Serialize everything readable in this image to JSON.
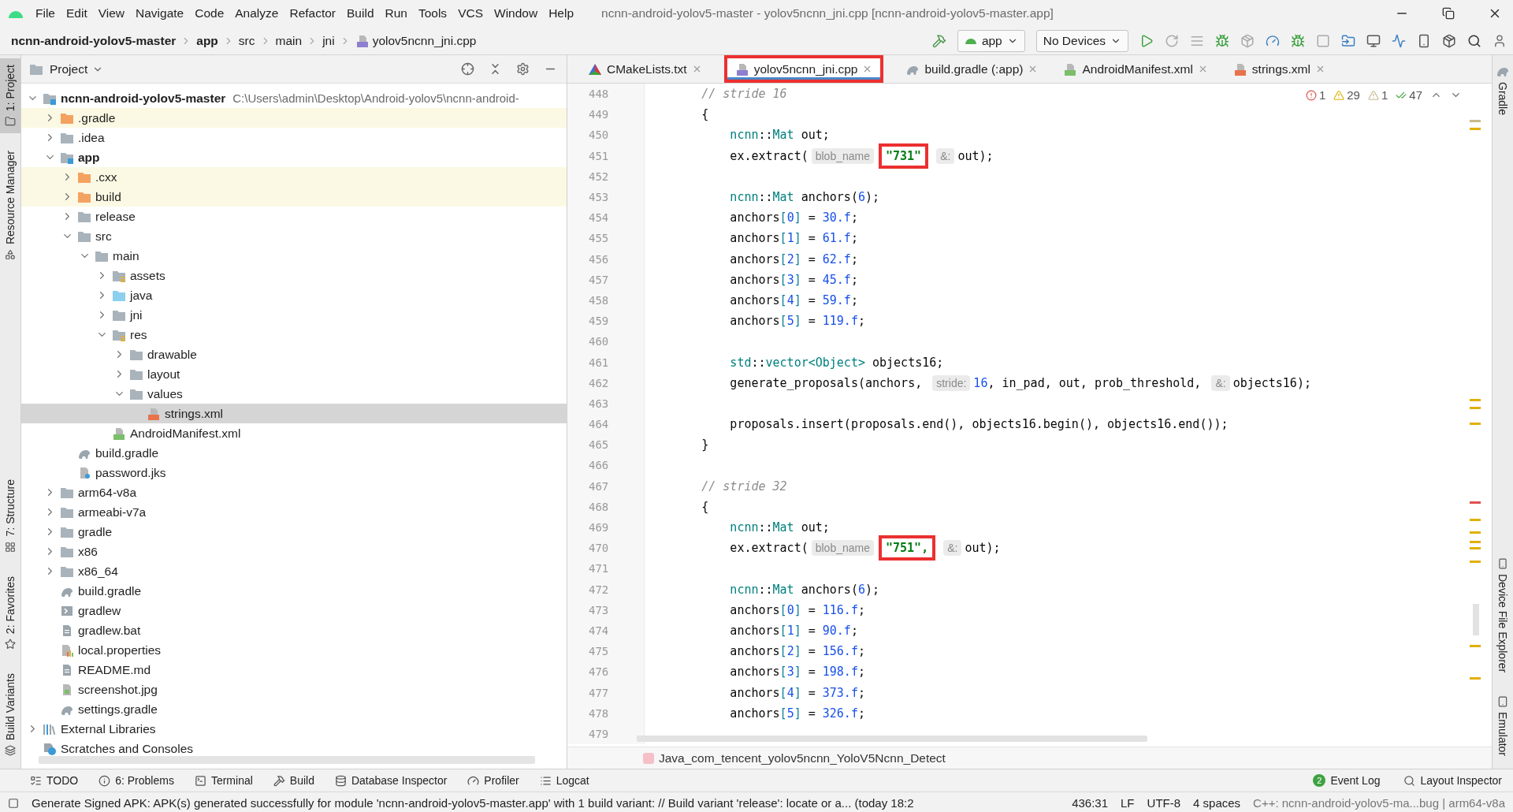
{
  "menu_bar": {
    "items": [
      "File",
      "Edit",
      "View",
      "Navigate",
      "Code",
      "Analyze",
      "Refactor",
      "Build",
      "Run",
      "Tools",
      "VCS",
      "Window",
      "Help"
    ],
    "title": "ncnn-android-yolov5-master - yolov5ncnn_jni.cpp [ncnn-android-yolov5-master.app]"
  },
  "nav_bar": {
    "breadcrumbs": [
      {
        "label": "ncnn-android-yolov5-master",
        "kind": "module"
      },
      {
        "label": "app",
        "kind": "module"
      },
      {
        "label": "src",
        "kind": "folder"
      },
      {
        "label": "main",
        "kind": "folder"
      },
      {
        "label": "jni",
        "kind": "folder"
      },
      {
        "label": "yolov5ncnn_jni.cpp",
        "kind": "cpp"
      }
    ],
    "run_config": "app",
    "device": "No Devices"
  },
  "left_strip": {
    "top": [
      {
        "label": "1: Project",
        "kind": "folder",
        "selected": true
      },
      {
        "label": "Resource Manager",
        "kind": "shapes",
        "selected": false
      }
    ],
    "bottom": [
      {
        "label": "7: Structure",
        "kind": "structure",
        "selected": false
      },
      {
        "label": "2: Favorites",
        "kind": "star",
        "selected": false
      },
      {
        "label": "Build Variants",
        "kind": "variants",
        "selected": false
      }
    ]
  },
  "right_strip": {
    "top": [
      {
        "label": "Gradle",
        "kind": "elephant"
      }
    ],
    "bottom": [
      {
        "label": "Device File Explorer",
        "kind": "phone"
      },
      {
        "label": "Emulator",
        "kind": "emulator"
      }
    ]
  },
  "project_panel": {
    "title": "Project",
    "tree": [
      {
        "label": "ncnn-android-yolov5-master",
        "path": "C:\\Users\\admin\\Desktop\\Android-yolov5\\ncnn-android-",
        "kind": "module",
        "expanded": true,
        "selected": false,
        "excluded": false,
        "children": [
          {
            "label": ".gradle",
            "kind": "folder-orange",
            "expanded": false,
            "selected": false,
            "excluded": true
          },
          {
            "label": ".idea",
            "kind": "folder",
            "expanded": false,
            "selected": false,
            "excluded": false
          },
          {
            "label": "app",
            "kind": "module",
            "expanded": true,
            "selected": false,
            "excluded": false,
            "children": [
              {
                "label": ".cxx",
                "kind": "folder-orange",
                "expanded": false,
                "selected": false,
                "excluded": true
              },
              {
                "label": "build",
                "kind": "folder-orange",
                "expanded": false,
                "selected": false,
                "excluded": true
              },
              {
                "label": "release",
                "kind": "folder",
                "expanded": false,
                "selected": false,
                "excluded": false
              },
              {
                "label": "src",
                "kind": "folder",
                "expanded": true,
                "selected": false,
                "excluded": false,
                "children": [
                  {
                    "label": "main",
                    "kind": "folder",
                    "expanded": true,
                    "selected": false,
                    "excluded": false,
                    "children": [
                      {
                        "label": "assets",
                        "kind": "res-folder",
                        "expanded": false,
                        "selected": false,
                        "excluded": false
                      },
                      {
                        "label": "java",
                        "kind": "folder-blue",
                        "expanded": false,
                        "selected": false,
                        "excluded": false
                      },
                      {
                        "label": "jni",
                        "kind": "folder",
                        "expanded": false,
                        "selected": false,
                        "excluded": false
                      },
                      {
                        "label": "res",
                        "kind": "res-folder",
                        "expanded": true,
                        "selected": false,
                        "excluded": false,
                        "children": [
                          {
                            "label": "drawable",
                            "kind": "folder",
                            "expanded": false,
                            "selected": false,
                            "excluded": false
                          },
                          {
                            "label": "layout",
                            "kind": "folder",
                            "expanded": false,
                            "selected": false,
                            "excluded": false
                          },
                          {
                            "label": "values",
                            "kind": "folder",
                            "expanded": true,
                            "selected": false,
                            "excluded": false,
                            "children": [
                              {
                                "label": "strings.xml",
                                "kind": "xml",
                                "selected": true,
                                "excluded": false
                              }
                            ]
                          }
                        ]
                      },
                      {
                        "label": "AndroidManifest.xml",
                        "kind": "manifest",
                        "selected": false,
                        "excluded": false
                      }
                    ]
                  }
                ]
              },
              {
                "label": "build.gradle",
                "kind": "gradle",
                "selected": false,
                "excluded": false
              },
              {
                "label": "password.jks",
                "kind": "key",
                "selected": false,
                "excluded": false
              }
            ]
          },
          {
            "label": "arm64-v8a",
            "kind": "folder",
            "expanded": false,
            "selected": false,
            "excluded": false
          },
          {
            "label": "armeabi-v7a",
            "kind": "folder",
            "expanded": false,
            "selected": false,
            "excluded": false
          },
          {
            "label": "gradle",
            "kind": "folder",
            "expanded": false,
            "selected": false,
            "excluded": false
          },
          {
            "label": "x86",
            "kind": "folder",
            "expanded": false,
            "selected": false,
            "excluded": false
          },
          {
            "label": "x86_64",
            "kind": "folder",
            "expanded": false,
            "selected": false,
            "excluded": false
          },
          {
            "label": "build.gradle",
            "kind": "gradle",
            "selected": false,
            "excluded": false
          },
          {
            "label": "gradlew",
            "kind": "script",
            "selected": false,
            "excluded": false
          },
          {
            "label": "gradlew.bat",
            "kind": "text",
            "selected": false,
            "excluded": false
          },
          {
            "label": "local.properties",
            "kind": "properties",
            "selected": false,
            "excluded": false
          },
          {
            "label": "README.md",
            "kind": "text",
            "selected": false,
            "excluded": false
          },
          {
            "label": "screenshot.jpg",
            "kind": "image",
            "selected": false,
            "excluded": false
          },
          {
            "label": "settings.gradle",
            "kind": "gradle",
            "selected": false,
            "excluded": false
          }
        ]
      },
      {
        "label": "External Libraries",
        "kind": "libraries",
        "expanded": false,
        "selected": false,
        "excluded": false
      },
      {
        "label": "Scratches and Consoles",
        "kind": "scratches",
        "selected": false,
        "excluded": false
      }
    ]
  },
  "editor": {
    "tabs": [
      {
        "label": "CMakeLists.txt",
        "kind": "cmake",
        "selected": false,
        "marked": false
      },
      {
        "label": "yolov5ncnn_jni.cpp",
        "kind": "cpp",
        "selected": true,
        "marked": true
      },
      {
        "label": "build.gradle (:app)",
        "kind": "gradle",
        "selected": false,
        "marked": false
      },
      {
        "label": "AndroidManifest.xml",
        "kind": "manifest",
        "selected": false,
        "marked": false
      },
      {
        "label": "strings.xml",
        "kind": "xml",
        "selected": false,
        "marked": false
      }
    ],
    "inspections": {
      "errors": "1",
      "warnings": "29",
      "weak_warnings": "1",
      "passed": "47"
    },
    "lines": [
      {
        "number": "448",
        "tokens": [
          {
            "kind": "comment",
            "text": "        // stride 16"
          }
        ]
      },
      {
        "number": "449",
        "tokens": [
          {
            "kind": "plain",
            "text": "        {"
          }
        ]
      },
      {
        "number": "450",
        "tokens": [
          {
            "kind": "type",
            "text": "            ncnn"
          },
          {
            "kind": "plain",
            "text": "::"
          },
          {
            "kind": "type",
            "text": "Mat"
          },
          {
            "kind": "plain",
            "text": " out;"
          }
        ]
      },
      {
        "number": "451",
        "tokens": [
          {
            "kind": "plain",
            "text": "            ex.extract("
          },
          {
            "kind": "hint",
            "text": "blob_name"
          },
          {
            "kind": "marked",
            "text": "\"731\""
          },
          {
            "kind": "hint",
            "text": "&:"
          },
          {
            "kind": "plain",
            "text": "out);"
          }
        ]
      },
      {
        "number": "452"
      },
      {
        "number": "453",
        "tokens": [
          {
            "kind": "type",
            "text": "            ncnn"
          },
          {
            "kind": "plain",
            "text": "::"
          },
          {
            "kind": "type",
            "text": "Mat"
          },
          {
            "kind": "plain",
            "text": " anchors("
          },
          {
            "kind": "number",
            "text": "6"
          },
          {
            "kind": "plain",
            "text": ");"
          }
        ]
      },
      {
        "number": "454",
        "tokens": [
          {
            "kind": "plain",
            "text": "            anchors"
          },
          {
            "kind": "bracket",
            "text": "["
          },
          {
            "kind": "number",
            "text": "0"
          },
          {
            "kind": "bracket",
            "text": "]"
          },
          {
            "kind": "plain",
            "text": " = "
          },
          {
            "kind": "number",
            "text": "30.f"
          },
          {
            "kind": "plain",
            "text": ";"
          }
        ]
      },
      {
        "number": "455",
        "tokens": [
          {
            "kind": "plain",
            "text": "            anchors"
          },
          {
            "kind": "bracket",
            "text": "["
          },
          {
            "kind": "number",
            "text": "1"
          },
          {
            "kind": "bracket",
            "text": "]"
          },
          {
            "kind": "plain",
            "text": " = "
          },
          {
            "kind": "number",
            "text": "61.f"
          },
          {
            "kind": "plain",
            "text": ";"
          }
        ]
      },
      {
        "number": "456",
        "tokens": [
          {
            "kind": "plain",
            "text": "            anchors"
          },
          {
            "kind": "bracket",
            "text": "["
          },
          {
            "kind": "number",
            "text": "2"
          },
          {
            "kind": "bracket",
            "text": "]"
          },
          {
            "kind": "plain",
            "text": " = "
          },
          {
            "kind": "number",
            "text": "62.f"
          },
          {
            "kind": "plain",
            "text": ";"
          }
        ]
      },
      {
        "number": "457",
        "tokens": [
          {
            "kind": "plain",
            "text": "            anchors"
          },
          {
            "kind": "bracket",
            "text": "["
          },
          {
            "kind": "number",
            "text": "3"
          },
          {
            "kind": "bracket",
            "text": "]"
          },
          {
            "kind": "plain",
            "text": " = "
          },
          {
            "kind": "number",
            "text": "45.f"
          },
          {
            "kind": "plain",
            "text": ";"
          }
        ]
      },
      {
        "number": "458",
        "tokens": [
          {
            "kind": "plain",
            "text": "            anchors"
          },
          {
            "kind": "bracket",
            "text": "["
          },
          {
            "kind": "number",
            "text": "4"
          },
          {
            "kind": "bracket",
            "text": "]"
          },
          {
            "kind": "plain",
            "text": " = "
          },
          {
            "kind": "number",
            "text": "59.f"
          },
          {
            "kind": "plain",
            "text": ";"
          }
        ]
      },
      {
        "number": "459",
        "tokens": [
          {
            "kind": "plain",
            "text": "            anchors"
          },
          {
            "kind": "bracket",
            "text": "["
          },
          {
            "kind": "number",
            "text": "5"
          },
          {
            "kind": "bracket",
            "text": "]"
          },
          {
            "kind": "plain",
            "text": " = "
          },
          {
            "kind": "number",
            "text": "119.f"
          },
          {
            "kind": "plain",
            "text": ";"
          }
        ]
      },
      {
        "number": "460"
      },
      {
        "number": "461",
        "tokens": [
          {
            "kind": "type",
            "text": "            std"
          },
          {
            "kind": "plain",
            "text": "::"
          },
          {
            "kind": "type",
            "text": "vector<Object>"
          },
          {
            "kind": "plain",
            "text": " objects16;"
          }
        ]
      },
      {
        "number": "462",
        "tokens": [
          {
            "kind": "plain",
            "text": "            generate_proposals(anchors, "
          },
          {
            "kind": "hint",
            "text": "stride:"
          },
          {
            "kind": "number",
            "text": "16"
          },
          {
            "kind": "plain",
            "text": ", in_pad, out, prob_threshold, "
          },
          {
            "kind": "hint",
            "text": "&:"
          },
          {
            "kind": "plain",
            "text": "objects16);"
          }
        ]
      },
      {
        "number": "463"
      },
      {
        "number": "464",
        "tokens": [
          {
            "kind": "plain",
            "text": "            proposals.insert(proposals.end(), objects16.begin(), objects16.end());"
          }
        ]
      },
      {
        "number": "465",
        "tokens": [
          {
            "kind": "plain",
            "text": "        }"
          }
        ]
      },
      {
        "number": "466"
      },
      {
        "number": "467",
        "tokens": [
          {
            "kind": "comment",
            "text": "        // stride 32"
          }
        ]
      },
      {
        "number": "468",
        "tokens": [
          {
            "kind": "plain",
            "text": "        {"
          }
        ]
      },
      {
        "number": "469",
        "tokens": [
          {
            "kind": "type",
            "text": "            ncnn"
          },
          {
            "kind": "plain",
            "text": "::"
          },
          {
            "kind": "type",
            "text": "Mat"
          },
          {
            "kind": "plain",
            "text": " out;"
          }
        ]
      },
      {
        "number": "470",
        "tokens": [
          {
            "kind": "plain",
            "text": "            ex.extract("
          },
          {
            "kind": "hint",
            "text": "blob_name"
          },
          {
            "kind": "marked",
            "text": "\"751\","
          },
          {
            "kind": "hint",
            "text": "&:"
          },
          {
            "kind": "plain",
            "text": "out);"
          }
        ]
      },
      {
        "number": "471"
      },
      {
        "number": "472",
        "tokens": [
          {
            "kind": "type",
            "text": "            ncnn"
          },
          {
            "kind": "plain",
            "text": "::"
          },
          {
            "kind": "type",
            "text": "Mat"
          },
          {
            "kind": "plain",
            "text": " anchors("
          },
          {
            "kind": "number",
            "text": "6"
          },
          {
            "kind": "plain",
            "text": ");"
          }
        ]
      },
      {
        "number": "473",
        "tokens": [
          {
            "kind": "plain",
            "text": "            anchors"
          },
          {
            "kind": "bracket",
            "text": "["
          },
          {
            "kind": "number",
            "text": "0"
          },
          {
            "kind": "bracket",
            "text": "]"
          },
          {
            "kind": "plain",
            "text": " = "
          },
          {
            "kind": "number",
            "text": "116.f"
          },
          {
            "kind": "plain",
            "text": ";"
          }
        ]
      },
      {
        "number": "474",
        "tokens": [
          {
            "kind": "plain",
            "text": "            anchors"
          },
          {
            "kind": "bracket",
            "text": "["
          },
          {
            "kind": "number",
            "text": "1"
          },
          {
            "kind": "bracket",
            "text": "]"
          },
          {
            "kind": "plain",
            "text": " = "
          },
          {
            "kind": "number",
            "text": "90.f"
          },
          {
            "kind": "plain",
            "text": ";"
          }
        ]
      },
      {
        "number": "475",
        "tokens": [
          {
            "kind": "plain",
            "text": "            anchors"
          },
          {
            "kind": "bracket",
            "text": "["
          },
          {
            "kind": "number",
            "text": "2"
          },
          {
            "kind": "bracket",
            "text": "]"
          },
          {
            "kind": "plain",
            "text": " = "
          },
          {
            "kind": "number",
            "text": "156.f"
          },
          {
            "kind": "plain",
            "text": ";"
          }
        ]
      },
      {
        "number": "476",
        "tokens": [
          {
            "kind": "plain",
            "text": "            anchors"
          },
          {
            "kind": "bracket",
            "text": "["
          },
          {
            "kind": "number",
            "text": "3"
          },
          {
            "kind": "bracket",
            "text": "]"
          },
          {
            "kind": "plain",
            "text": " = "
          },
          {
            "kind": "number",
            "text": "198.f"
          },
          {
            "kind": "plain",
            "text": ";"
          }
        ]
      },
      {
        "number": "477",
        "tokens": [
          {
            "kind": "plain",
            "text": "            anchors"
          },
          {
            "kind": "bracket",
            "text": "["
          },
          {
            "kind": "number",
            "text": "4"
          },
          {
            "kind": "bracket",
            "text": "]"
          },
          {
            "kind": "plain",
            "text": " = "
          },
          {
            "kind": "number",
            "text": "373.f"
          },
          {
            "kind": "plain",
            "text": ";"
          }
        ]
      },
      {
        "number": "478",
        "tokens": [
          {
            "kind": "plain",
            "text": "            anchors"
          },
          {
            "kind": "bracket",
            "text": "["
          },
          {
            "kind": "number",
            "text": "5"
          },
          {
            "kind": "bracket",
            "text": "]"
          },
          {
            "kind": "plain",
            "text": " = "
          },
          {
            "kind": "number",
            "text": "326.f"
          },
          {
            "kind": "plain",
            "text": ";"
          }
        ]
      },
      {
        "number": "479"
      }
    ],
    "breadcrumb": "Java_com_tencent_yolov5ncnn_YoloV5Ncnn_Detect"
  },
  "tool_bar": {
    "left": [
      {
        "label": "TODO",
        "kind": "todo"
      },
      {
        "label": "6: Problems",
        "kind": "problems"
      },
      {
        "label": "Terminal",
        "kind": "terminal"
      },
      {
        "label": "Build",
        "kind": "build"
      },
      {
        "label": "Database Inspector",
        "kind": "database"
      },
      {
        "label": "Profiler",
        "kind": "profiler"
      },
      {
        "label": "Logcat",
        "kind": "logcat"
      }
    ],
    "right": [
      {
        "label": "Event Log",
        "badge": "2"
      },
      {
        "label": "Layout Inspector",
        "kind": "layout"
      }
    ]
  },
  "status_bar": {
    "message": "Generate Signed APK: APK(s) generated successfully for module 'ncnn-android-yolov5-master.app' with 1 build variant: // Build variant 'release': locate or a... (today 18:2",
    "position": "436:31",
    "line_separator": "LF",
    "encoding": "UTF-8",
    "indent": "4 spaces",
    "context": "C++: ncnn-android-yolov5-ma...bug | arm64-v8a"
  }
}
